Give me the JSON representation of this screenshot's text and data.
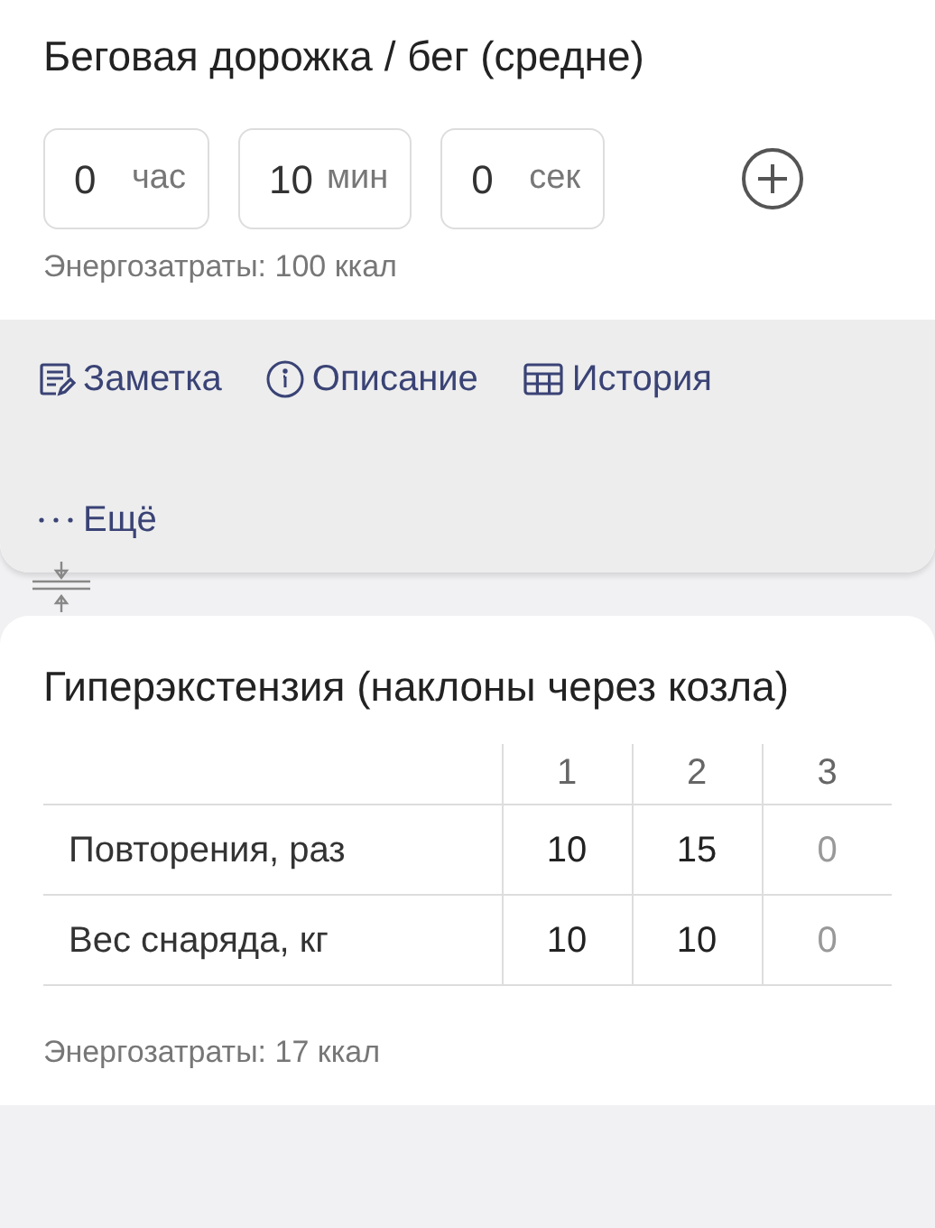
{
  "cards": [
    {
      "kind": "timed",
      "title": "Беговая дорожка / бег (средне)",
      "duration": [
        {
          "value": "0",
          "unit": "час"
        },
        {
          "value": "10",
          "unit": "мин"
        },
        {
          "value": "0",
          "unit": "сек"
        }
      ],
      "energy": "Энергозатраты: 100 ккал",
      "actions": [
        {
          "kind": "note",
          "label": "Заметка"
        },
        {
          "kind": "info",
          "label": "Описание"
        },
        {
          "kind": "table",
          "label": "История"
        },
        {
          "kind": "more",
          "label": "Ещё"
        }
      ]
    },
    {
      "kind": "sets",
      "title": "Гиперэкстензия (наклоны через козла)",
      "table": {
        "columns": [
          "1",
          "2",
          "3"
        ],
        "rows": [
          {
            "label": "Повторения, раз",
            "cells": [
              {
                "text": "10",
                "empty": false
              },
              {
                "text": "15",
                "empty": false
              },
              {
                "text": "0",
                "empty": true
              }
            ]
          },
          {
            "label": "Вес снаряда, кг",
            "cells": [
              {
                "text": "10",
                "empty": false
              },
              {
                "text": "10",
                "empty": false
              },
              {
                "text": "0",
                "empty": true
              }
            ]
          }
        ]
      },
      "energy": "Энергозатраты: 17 ккал"
    }
  ]
}
